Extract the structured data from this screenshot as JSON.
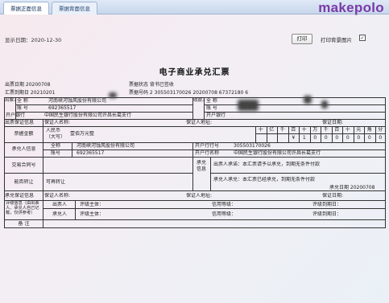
{
  "tabs": [
    "票据正面信息",
    "票据背面信息"
  ],
  "logo": "makepolo",
  "toolbar": {
    "show_date": "显示日期：2020-12-30",
    "print": "打印",
    "print_bg": "打印背景图片",
    "print_bg_checked": "✓"
  },
  "title": "电子商业承兑汇票",
  "meta": {
    "issue_date": "出票日期 20200708",
    "due_date": "汇票到期日 20210201",
    "status": "票据状态 背书已签收",
    "number": "票据号码 2 305503170026 20200708 67372180 6"
  },
  "drawer": {
    "side": "出票人",
    "full_name_label": "全 称",
    "full_name": "河南峡河蚀风股份有限公司",
    "account_label": "账 号",
    "account": "692365517",
    "bank_label": "开户银行",
    "bank": "中国民生银行股份有限公司许昌长葛支行"
  },
  "payee": {
    "side": "收款人",
    "full_name_label": "全 称",
    "account_label": "账 号",
    "bank_label": "开户银行"
  },
  "guarantee_row": {
    "label": "出票保证信息",
    "name": "保证人名称:",
    "addr": "保证人地址:",
    "date": "保证日期:"
  },
  "amount": {
    "label": "票据金额",
    "rmb": "人民币",
    "upper": "（大写）",
    "text": "壹佰万元整",
    "units": [
      "十",
      "亿",
      "千",
      "百",
      "十",
      "万",
      "千",
      "百",
      "十",
      "元",
      "角",
      "分"
    ],
    "digits": [
      "",
      "",
      "",
      "¥",
      "1",
      "0",
      "0",
      "0",
      "0",
      "0",
      "0",
      "0"
    ]
  },
  "acceptor": {
    "label": "承兑人信息",
    "full_name_label": "全称",
    "full_name": "河南峡河蚀风股份有限公司",
    "account_label": "账号",
    "account": "692365517",
    "bank_no_label": "开户行行号",
    "bank_no": "305503170026",
    "bank_name_label": "开户行名称",
    "bank_name": "中国民生银行股份有限公司许昌长葛支行"
  },
  "contract": {
    "label": "交易合同号"
  },
  "transfer": {
    "label": "能否转让",
    "value": "可再转让"
  },
  "accept_info": {
    "label": "承兑信息",
    "drawer_promise": "出票人承诺：本汇票请予以承兑，到期无条件付款",
    "acceptor_promise": "承兑人承兑：本汇票已经承兑，到期无条件付款",
    "accept_date": "承兑日期 20200708"
  },
  "accept_guarantee": {
    "label": "承兑保证信息",
    "name": "保证人名称:",
    "addr": "保证人地址:",
    "date": "保证日期:"
  },
  "rating": {
    "label": "评级信息（由出票人、承兑人自己记载，仅供参考）",
    "rows": [
      {
        "who": "出票人",
        "org": "评级主体：",
        "level": "信用等级：",
        "due": "评级到期日："
      },
      {
        "who": "承兑人",
        "org": "评级主体：",
        "level": "信用等级：",
        "due": "评级到期日："
      }
    ]
  },
  "remark": {
    "label": "备 注"
  }
}
